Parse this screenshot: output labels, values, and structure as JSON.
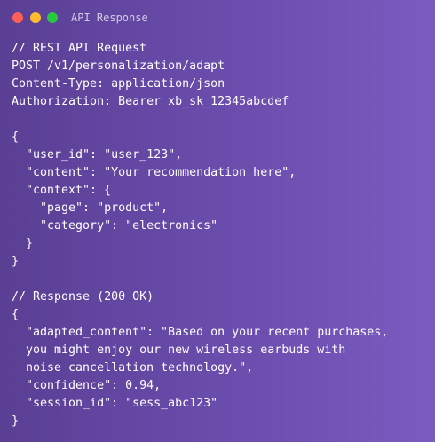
{
  "window": {
    "title": "API Response",
    "controls": {
      "close_color": "#ff5f57",
      "minimize_color": "#febc2e",
      "maximize_color": "#28c840"
    }
  },
  "code": {
    "lines": [
      "// REST API Request",
      "POST /v1/personalization/adapt",
      "Content-Type: application/json",
      "Authorization: Bearer xb_sk_12345abcdef",
      "",
      "{",
      "  \"user_id\": \"user_123\",",
      "  \"content\": \"Your recommendation here\",",
      "  \"context\": {",
      "    \"page\": \"product\",",
      "    \"category\": \"electronics\"",
      "  }",
      "}",
      "",
      "// Response (200 OK)",
      "{",
      "  \"adapted_content\": \"Based on your recent purchases,",
      "  you might enjoy our new wireless earbuds with",
      "  noise cancellation technology.\",",
      "  \"confidence\": 0.94,",
      "  \"session_id\": \"sess_abc123\"",
      "}"
    ]
  }
}
